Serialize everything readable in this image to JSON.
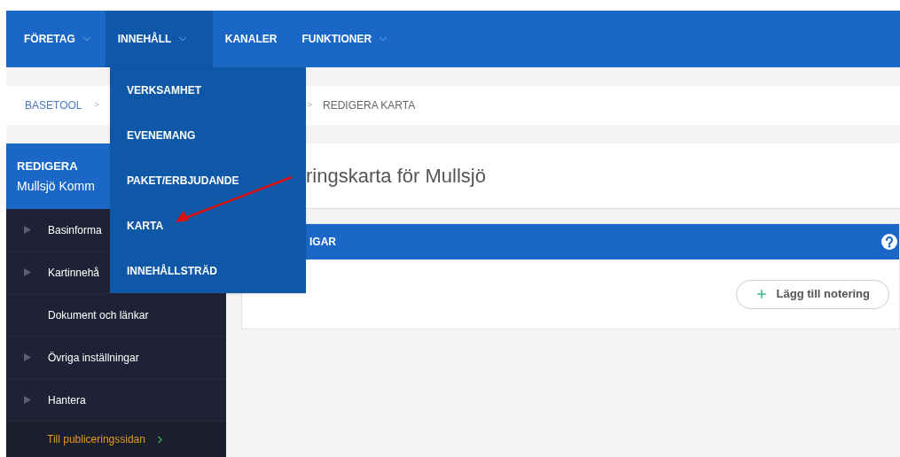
{
  "nav": [
    {
      "label": "FÖRETAG",
      "dropdown": true,
      "selected": false
    },
    {
      "label": "INNEHÅLL",
      "dropdown": true,
      "selected": true
    },
    {
      "label": "KANALER",
      "dropdown": false,
      "selected": false
    },
    {
      "label": "FUNKTIONER",
      "dropdown": true,
      "selected": false
    }
  ],
  "dropdown_menu": [
    "VERKSAMHET",
    "EVENEMANG",
    "PAKET/ERBJUDANDE",
    "KARTA",
    "INNEHÅLLSTRÄD"
  ],
  "breadcrumb": {
    "first": "BASETOOL",
    "separator_1": ">",
    "separator_2": ">",
    "current": "REDIGERA KARTA"
  },
  "sidebar": {
    "title": "REDIGERA",
    "subtitle": "Mullsjö Komm",
    "items": [
      {
        "label": "Basinforma",
        "expandable": true
      },
      {
        "label": "Kartinnehå",
        "expandable": true
      },
      {
        "label": "Dokument och länkar",
        "expandable": false
      },
      {
        "label": "Övriga inställningar",
        "expandable": true
      },
      {
        "label": "Hantera",
        "expandable": true
      }
    ],
    "footer_link": "Till publiceringssidan"
  },
  "page_title": "ringskarta för Mullsjö",
  "panel": {
    "title": "IGAR",
    "button": "Lägg till notering"
  }
}
